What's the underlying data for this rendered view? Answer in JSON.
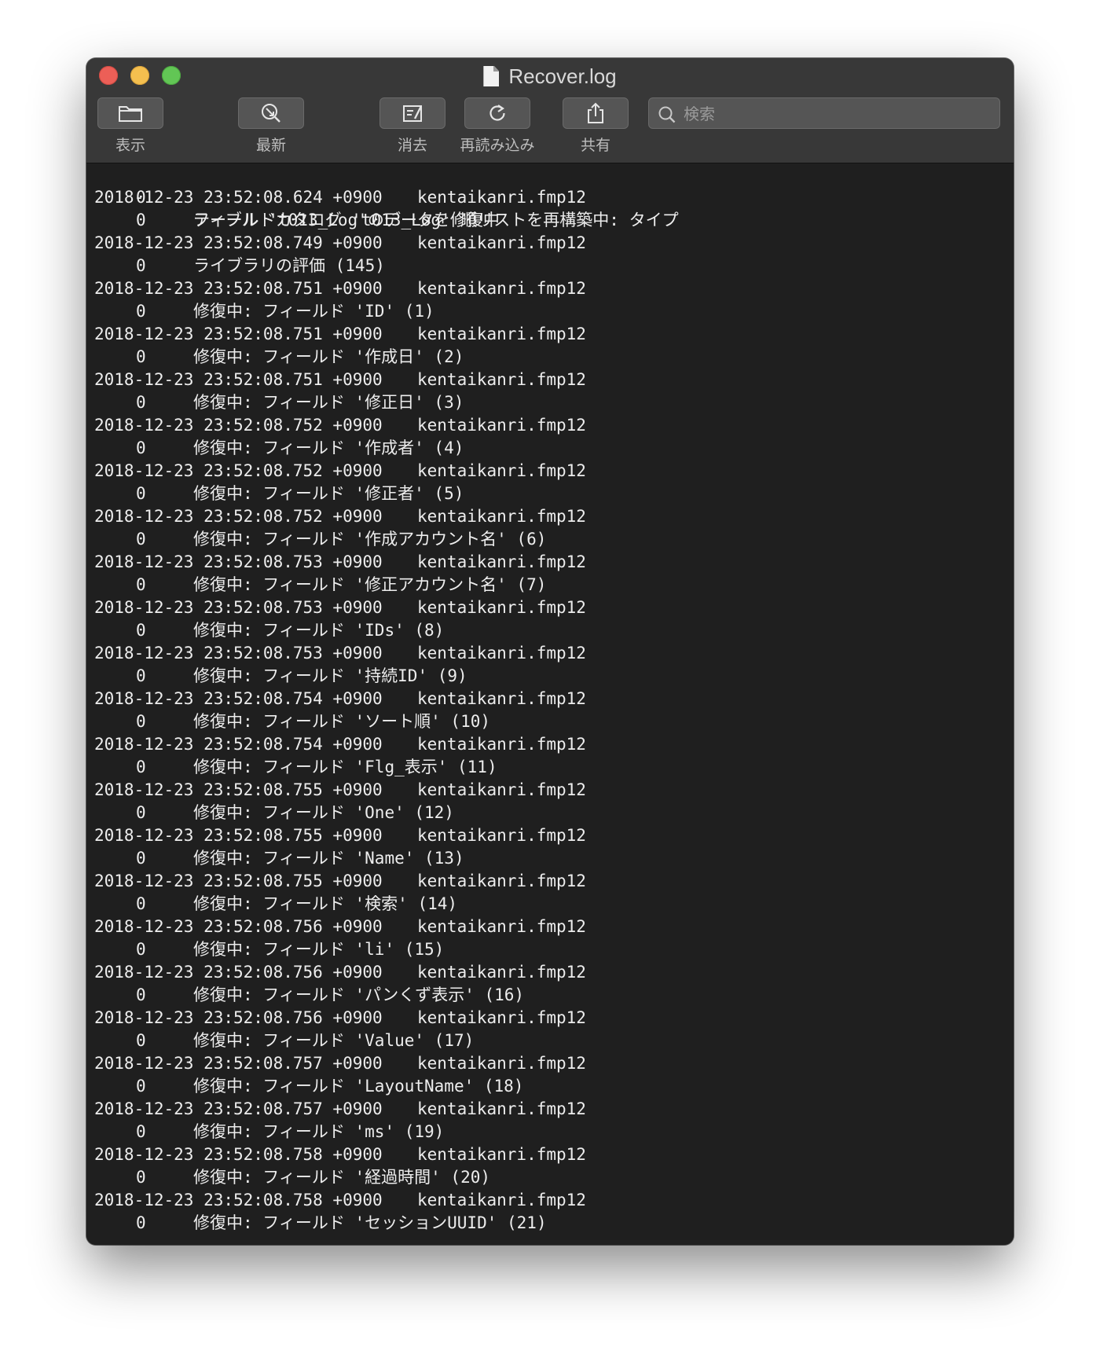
{
  "window": {
    "title": "Recover.log"
  },
  "toolbar": {
    "show_label": "表示",
    "latest_label": "最新",
    "clear_label": "消去",
    "reload_label": "再読み込み",
    "share_label": "共有",
    "search_placeholder": "検索"
  },
  "log": {
    "first_line": {
      "code": "0",
      "text": "フィールドカタログ 't013_Log' 順リストを再構築中: タイプ"
    },
    "entries": [
      {
        "timestamp": "2018-12-23 23:52:08.624 +0900",
        "file": "kentaikanri.fmp12",
        "code": "0",
        "text": "テーブル 't013_Log'のデータを修復中"
      },
      {
        "timestamp": "2018-12-23 23:52:08.749 +0900",
        "file": "kentaikanri.fmp12",
        "code": "0",
        "text": "ライブラリの評価 (145)"
      },
      {
        "timestamp": "2018-12-23 23:52:08.751 +0900",
        "file": "kentaikanri.fmp12",
        "code": "0",
        "text": "修復中: フィールド 'ID' (1)"
      },
      {
        "timestamp": "2018-12-23 23:52:08.751 +0900",
        "file": "kentaikanri.fmp12",
        "code": "0",
        "text": "修復中: フィールド '作成日' (2)"
      },
      {
        "timestamp": "2018-12-23 23:52:08.751 +0900",
        "file": "kentaikanri.fmp12",
        "code": "0",
        "text": "修復中: フィールド '修正日' (3)"
      },
      {
        "timestamp": "2018-12-23 23:52:08.752 +0900",
        "file": "kentaikanri.fmp12",
        "code": "0",
        "text": "修復中: フィールド '作成者' (4)"
      },
      {
        "timestamp": "2018-12-23 23:52:08.752 +0900",
        "file": "kentaikanri.fmp12",
        "code": "0",
        "text": "修復中: フィールド '修正者' (5)"
      },
      {
        "timestamp": "2018-12-23 23:52:08.752 +0900",
        "file": "kentaikanri.fmp12",
        "code": "0",
        "text": "修復中: フィールド '作成アカウント名' (6)"
      },
      {
        "timestamp": "2018-12-23 23:52:08.753 +0900",
        "file": "kentaikanri.fmp12",
        "code": "0",
        "text": "修復中: フィールド '修正アカウント名' (7)"
      },
      {
        "timestamp": "2018-12-23 23:52:08.753 +0900",
        "file": "kentaikanri.fmp12",
        "code": "0",
        "text": "修復中: フィールド 'IDs' (8)"
      },
      {
        "timestamp": "2018-12-23 23:52:08.753 +0900",
        "file": "kentaikanri.fmp12",
        "code": "0",
        "text": "修復中: フィールド '持続ID' (9)"
      },
      {
        "timestamp": "2018-12-23 23:52:08.754 +0900",
        "file": "kentaikanri.fmp12",
        "code": "0",
        "text": "修復中: フィールド 'ソート順' (10)"
      },
      {
        "timestamp": "2018-12-23 23:52:08.754 +0900",
        "file": "kentaikanri.fmp12",
        "code": "0",
        "text": "修復中: フィールド 'Flg_表示' (11)"
      },
      {
        "timestamp": "2018-12-23 23:52:08.755 +0900",
        "file": "kentaikanri.fmp12",
        "code": "0",
        "text": "修復中: フィールド 'One' (12)"
      },
      {
        "timestamp": "2018-12-23 23:52:08.755 +0900",
        "file": "kentaikanri.fmp12",
        "code": "0",
        "text": "修復中: フィールド 'Name' (13)"
      },
      {
        "timestamp": "2018-12-23 23:52:08.755 +0900",
        "file": "kentaikanri.fmp12",
        "code": "0",
        "text": "修復中: フィールド '検索' (14)"
      },
      {
        "timestamp": "2018-12-23 23:52:08.756 +0900",
        "file": "kentaikanri.fmp12",
        "code": "0",
        "text": "修復中: フィールド 'li' (15)"
      },
      {
        "timestamp": "2018-12-23 23:52:08.756 +0900",
        "file": "kentaikanri.fmp12",
        "code": "0",
        "text": "修復中: フィールド 'パンくず表示' (16)"
      },
      {
        "timestamp": "2018-12-23 23:52:08.756 +0900",
        "file": "kentaikanri.fmp12",
        "code": "0",
        "text": "修復中: フィールド 'Value' (17)"
      },
      {
        "timestamp": "2018-12-23 23:52:08.757 +0900",
        "file": "kentaikanri.fmp12",
        "code": "0",
        "text": "修復中: フィールド 'LayoutName' (18)"
      },
      {
        "timestamp": "2018-12-23 23:52:08.757 +0900",
        "file": "kentaikanri.fmp12",
        "code": "0",
        "text": "修復中: フィールド 'ms' (19)"
      },
      {
        "timestamp": "2018-12-23 23:52:08.758 +0900",
        "file": "kentaikanri.fmp12",
        "code": "0",
        "text": "修復中: フィールド '経過時間' (20)"
      },
      {
        "timestamp": "2018-12-23 23:52:08.758 +0900",
        "file": "kentaikanri.fmp12",
        "code": "0",
        "text": "修復中: フィールド 'セッションUUID' (21)"
      }
    ]
  }
}
